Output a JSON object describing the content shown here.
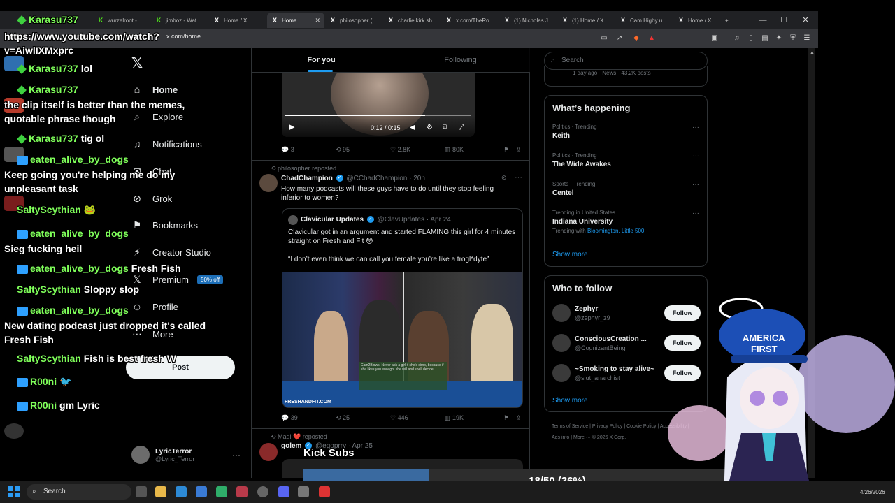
{
  "browser": {
    "tabs": [
      {
        "label": "wurzelroot -",
        "fav": "K",
        "active": false
      },
      {
        "label": "jimboz - Wat",
        "fav": "K",
        "active": false
      },
      {
        "label": "Home / X",
        "fav": "X",
        "active": false
      },
      {
        "label": "Home",
        "fav": "X",
        "active": true
      },
      {
        "label": "philosopher (",
        "fav": "X",
        "active": false
      },
      {
        "label": "charlie kirk sh",
        "fav": "X",
        "active": false
      },
      {
        "label": "x.com/TheRo",
        "fav": "X",
        "active": false
      },
      {
        "label": "(1) Nicholas J",
        "fav": "X",
        "active": false
      },
      {
        "label": "(1) Home / X",
        "fav": "X",
        "active": false
      },
      {
        "label": "Cam Higby u",
        "fav": "X",
        "active": false
      },
      {
        "label": "Home / X",
        "fav": "X",
        "active": false
      }
    ],
    "new_tab": "+",
    "address": "x.com/home",
    "minimize": "—",
    "maximize": "☐",
    "close": "✕"
  },
  "nav": {
    "logo": "𝕏",
    "items": [
      {
        "label": "Home",
        "icon": "home-icon",
        "glyph": "⌂",
        "bold": true
      },
      {
        "label": "Explore",
        "icon": "search-icon",
        "glyph": "⌕",
        "bold": false
      },
      {
        "label": "Notifications",
        "icon": "bell-icon",
        "glyph": "♫",
        "bold": false
      },
      {
        "label": "Chat",
        "icon": "chat-icon",
        "glyph": "✉",
        "bold": false
      },
      {
        "label": "Grok",
        "icon": "grok-icon",
        "glyph": "⊘",
        "bold": false
      },
      {
        "label": "Bookmarks",
        "icon": "bookmark-icon",
        "glyph": "⚑",
        "bold": false
      },
      {
        "label": "Creator Studio",
        "icon": "creator-icon",
        "glyph": "⚡",
        "bold": false
      },
      {
        "label": "Premium",
        "icon": "premium-icon",
        "glyph": "𝕏",
        "bold": false
      },
      {
        "label": "Profile",
        "icon": "profile-icon",
        "glyph": "☺",
        "bold": false
      },
      {
        "label": "More",
        "icon": "more-icon",
        "glyph": "⋯",
        "bold": false
      }
    ],
    "premium_badge": "50% off",
    "post_button": "Post",
    "profile": {
      "name": "LyricTerror",
      "handle": "@Lyric_Terror",
      "more": "···"
    }
  },
  "feed": {
    "tabs": [
      "For you",
      "Following"
    ],
    "video": {
      "time": "0:12 / 0:15",
      "play": "▶"
    },
    "actions1": {
      "replies": "3",
      "reposts": "95",
      "likes": "2.8K",
      "views": "80K"
    },
    "tweet2": {
      "repost_line": "philosopher reposted",
      "name": "ChadChampion",
      "handle": "@CChadChampion",
      "time": "· 20h",
      "text": "How many podcasts will these guys have to do until they stop feeling inferior to women?",
      "quote": {
        "name": "Clavicular Updates",
        "handle": "@ClavUpdates",
        "time": "· Apr 24",
        "text1": "Clavicular got in an argument and started FLAMING this girl for 4 minutes straight on Fresh and Fit 😳",
        "text2": "“I don’t even think we can call you female you’re like a trogl*dyte”",
        "watermark": "FRESHANDFIT.COM",
        "overlay": "Cam2Blows: Never ask a girl if she's simp, because if she likes you enough, she will and shell decide..."
      },
      "actions": {
        "replies": "39",
        "reposts": "25",
        "likes": "446",
        "views": "19K"
      }
    },
    "tweet3": {
      "repost_line": "Madi ❤️ reposted",
      "name": "golem",
      "handle": "@egoprry",
      "time": "· Apr 25"
    }
  },
  "right": {
    "search_placeholder": "Search",
    "news_top": "1 day ago · News · 43.2K posts",
    "whats_happening": "What’s happening",
    "trends": [
      {
        "meta": "Politics · Trending",
        "name": "Keith"
      },
      {
        "meta": "Politics · Trending",
        "name": "The Wide Awakes"
      },
      {
        "meta": "Sports · Trending",
        "name": "Centel"
      },
      {
        "meta": "Trending in United States",
        "name": "Indiana University",
        "with_label": "Trending with",
        "with_links": "Bloomington, Little 500"
      }
    ],
    "show_more": "Show more",
    "who_to_follow": "Who to follow",
    "follows": [
      {
        "name": "Zephyr",
        "handle": "@zephyr_z9"
      },
      {
        "name": "ConsciousCreation ...",
        "handle": "@CognizantBeing"
      },
      {
        "name": "~Smoking to stay alive~",
        "handle": "@slut_anarchist"
      }
    ],
    "follow_label": "Follow",
    "footer": "Terms of Service | Privacy Policy | Cookie Policy | Accessibility | Ads info | More ··· © 2026 X Corp."
  },
  "chat": [
    {
      "type": "user",
      "user": "Karasu737",
      "msg": "",
      "badge": "green"
    },
    {
      "type": "msg",
      "text": "https://www.youtube.com/watch?v=AiwlIXMxprc"
    },
    {
      "type": "user",
      "user": "Karasu737",
      "msg": "lol",
      "badge": "green"
    },
    {
      "type": "user",
      "user": "Karasu737",
      "msg": "",
      "badge": "green"
    },
    {
      "type": "msg",
      "text": "the clip itself is better than the memes, quotable phrase though"
    },
    {
      "type": "user",
      "user": "Karasu737",
      "msg": "tig ol",
      "badge": "green"
    },
    {
      "type": "user",
      "user": "eaten_alive_by_dogs",
      "msg": "",
      "badge": "blue"
    },
    {
      "type": "msg",
      "text": "Keep going you're helping me do my unpleasant task"
    },
    {
      "type": "user",
      "user": "SaltyScythian",
      "msg": "🐸",
      "badge": "none"
    },
    {
      "type": "user",
      "user": "eaten_alive_by_dogs",
      "msg": "",
      "badge": "blue"
    },
    {
      "type": "msg",
      "text": "Sieg fucking heil"
    },
    {
      "type": "user",
      "user": "eaten_alive_by_dogs",
      "msg": "Fresh Fish",
      "badge": "blue"
    },
    {
      "type": "user",
      "user": "SaltyScythian",
      "msg": "Sloppy slop",
      "badge": "none"
    },
    {
      "type": "user",
      "user": "eaten_alive_by_dogs",
      "msg": "",
      "badge": "blue"
    },
    {
      "type": "msg",
      "text": "New dating podcast just dropped it's called Fresh Fish"
    },
    {
      "type": "user",
      "user": "SaltyScythian",
      "msg": "Fish is best fresh W",
      "badge": "none"
    },
    {
      "type": "user",
      "user": "R00ni",
      "msg": "🐦",
      "badge": "blue2"
    },
    {
      "type": "user",
      "user": "R00ni",
      "msg": "gm Lyric",
      "badge": "blue2"
    }
  ],
  "kick": {
    "label": "Kick Subs",
    "progress_text": "18/50 (36%)",
    "progress": 0.36
  },
  "taskbar": {
    "search": "Search",
    "date": "4/26/2026"
  },
  "colors": {
    "accent": "#1d9bf0",
    "chat_user": "#7fff5a"
  }
}
